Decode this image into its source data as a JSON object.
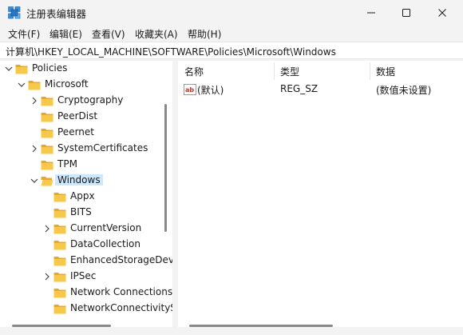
{
  "window": {
    "title": "注册表编辑器",
    "icon": "registry-editor-icon",
    "controls": [
      "minimize-icon",
      "maximize-icon",
      "close-icon"
    ]
  },
  "menu": [
    {
      "label": "文件(F)"
    },
    {
      "label": "编辑(E)"
    },
    {
      "label": "查看(V)"
    },
    {
      "label": "收藏夹(A)"
    },
    {
      "label": "帮助(H)"
    }
  ],
  "address": {
    "path": "计算机\\HKEY_LOCAL_MACHINE\\SOFTWARE\\Policies\\Microsoft\\Windows"
  },
  "tree": [
    {
      "label": "Policies",
      "expander": "expanded"
    },
    {
      "label": "Microsoft",
      "expander": "expanded"
    },
    {
      "label": "Cryptography",
      "expander": "collapsed"
    },
    {
      "label": "PeerDist",
      "expander": "none"
    },
    {
      "label": "Peernet",
      "expander": "none"
    },
    {
      "label": "SystemCertificates",
      "expander": "collapsed"
    },
    {
      "label": "TPM",
      "expander": "none"
    },
    {
      "label": "Windows",
      "expander": "expanded",
      "selected": true
    },
    {
      "label": "Appx",
      "expander": "none"
    },
    {
      "label": "BITS",
      "expander": "none"
    },
    {
      "label": "CurrentVersion",
      "expander": "collapsed"
    },
    {
      "label": "DataCollection",
      "expander": "none"
    },
    {
      "label": "EnhancedStorageDevices",
      "expander": "none"
    },
    {
      "label": "IPSec",
      "expander": "collapsed"
    },
    {
      "label": "Network Connections",
      "expander": "none"
    },
    {
      "label": "NetworkConnectivityStatusIndicator",
      "expander": "none"
    }
  ],
  "list": {
    "columns": [
      "名称",
      "类型",
      "数据"
    ],
    "rows": [
      {
        "name": "(默认)",
        "type": "REG_SZ",
        "data": "(数值未设置)",
        "icon": "string-value-icon"
      }
    ]
  },
  "colors": {
    "selection": "#cce8ff",
    "folder": "#f8c84a",
    "folder_dark": "#e7a82b",
    "chrome": "#f3f3f3"
  }
}
